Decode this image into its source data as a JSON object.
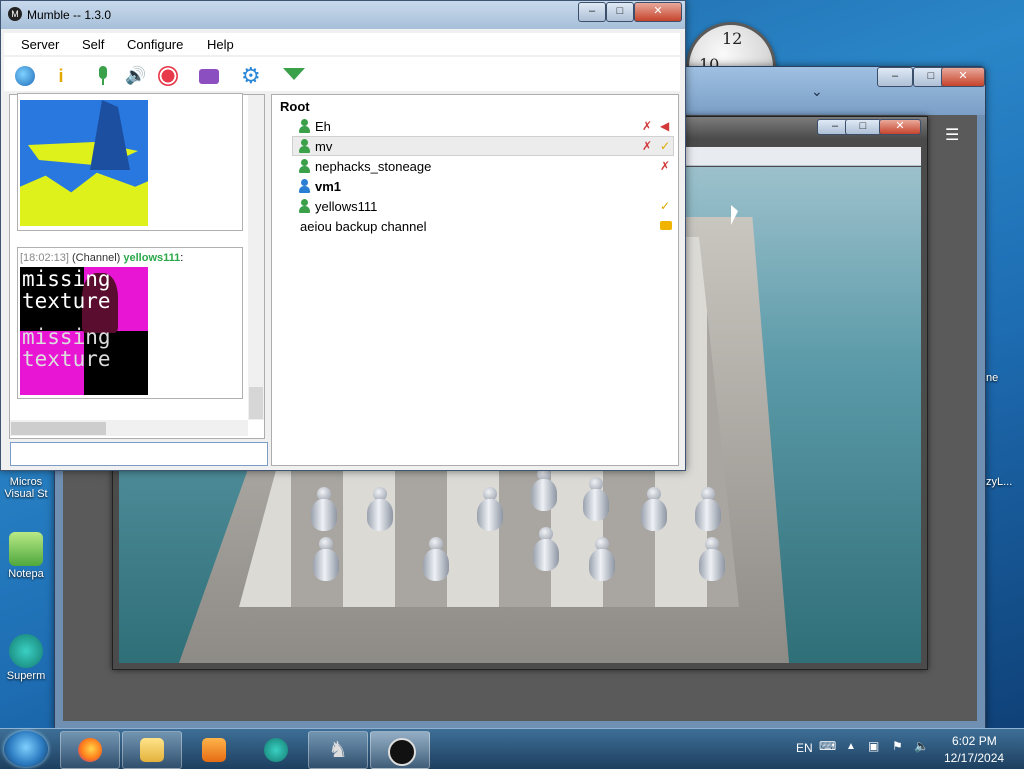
{
  "mumble": {
    "title": "Mumble -- 1.3.0",
    "menu": [
      "Server",
      "Self",
      "Configure",
      "Help"
    ],
    "toolbar_icons": [
      "connect-globe-icon",
      "info-icon",
      "microphone-icon",
      "speaker-icon",
      "record-icon",
      "comment-icon",
      "settings-gear-icon",
      "filter-icon"
    ]
  },
  "chat": {
    "messages": [
      {
        "time": "[18:02:13]",
        "scope": "(Channel)",
        "user": "yellows111",
        "colon": ":",
        "image_text": [
          "missing",
          "texture",
          "missing",
          "texture"
        ]
      }
    ],
    "input_value": ""
  },
  "tree": {
    "root_label": "Root",
    "users": [
      {
        "name": "Eh",
        "status": [
          "muted-mic-icon",
          "deafened-icon"
        ]
      },
      {
        "name": "mv",
        "status": [
          "muted-mic-icon",
          "check-icon"
        ]
      },
      {
        "name": "nephacks_stoneage",
        "status": [
          "muted-mic-icon"
        ]
      },
      {
        "name": "vm1",
        "status": []
      },
      {
        "name": "yellows111",
        "status": [
          "check-icon"
        ]
      }
    ],
    "channel": {
      "name": "aeiou backup channel",
      "status": "comment-icon"
    }
  },
  "desktop": {
    "left_icons": [
      "Micros\nVisual St",
      "Notepa",
      "Superm"
    ],
    "right_labels": [
      "ne",
      "zyL..."
    ]
  },
  "taskbar": {
    "language": "EN",
    "time": "6:02 PM",
    "date": "12/17/2024"
  }
}
